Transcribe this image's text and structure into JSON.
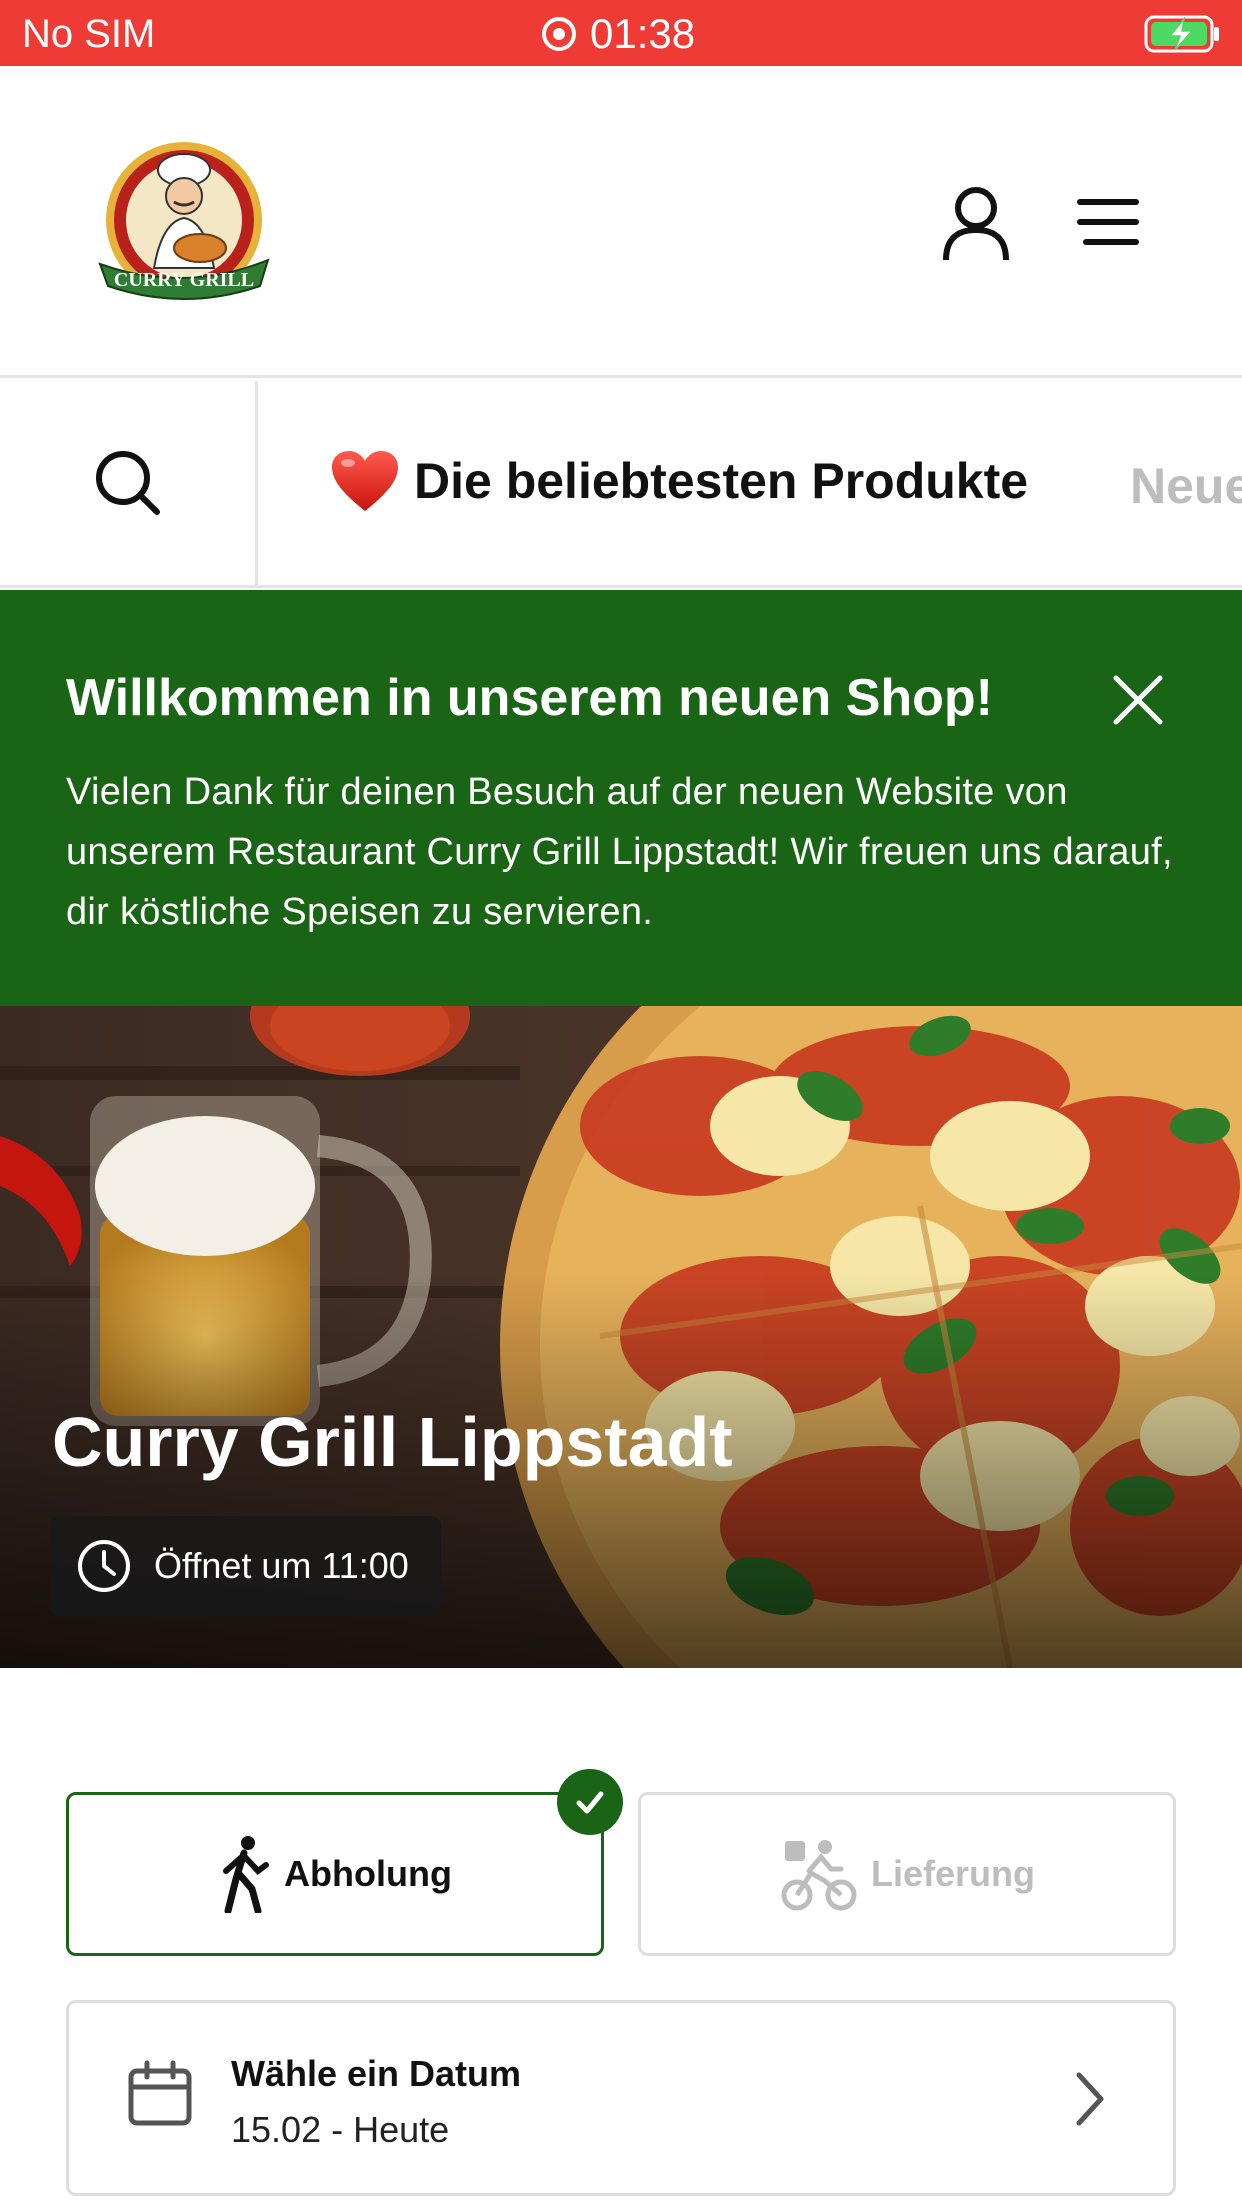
{
  "status_bar": {
    "carrier": "No SIM",
    "time": "01:38"
  },
  "header": {
    "logo_text": "CURRY GRILL"
  },
  "categories": {
    "popular_emoji": "❤️",
    "popular_label": "Die beliebtesten Produkte",
    "next_label": "Neue"
  },
  "welcome": {
    "title": "Willkommen in unserem neuen Shop!",
    "text": "Vielen Dank für deinen Besuch auf der neuen Website von unserem Restaurant Curry Grill Lippstadt! Wir freuen uns darauf, dir köstliche Speisen zu servieren."
  },
  "hero": {
    "restaurant_name": "Curry Grill Lippstadt",
    "opening_text": "Öffnet um 11:00"
  },
  "order_mode": {
    "pickup_label": "Abholung",
    "delivery_label": "Lieferung",
    "selected": "pickup"
  },
  "date": {
    "title": "Wähle ein Datum",
    "value": "15.02 - Heute"
  },
  "colors": {
    "status_bar": "#ef3b36",
    "brand_green": "#1a6416",
    "muted_text": "#bdbdbd"
  }
}
